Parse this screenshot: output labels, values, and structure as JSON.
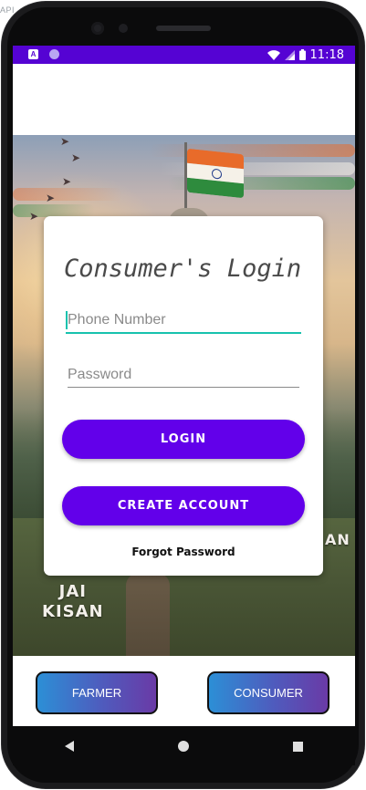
{
  "window": {
    "corner_label": "API"
  },
  "status_bar": {
    "time": "11:18",
    "accent_color": "#5503d3",
    "icons": [
      "notification-a-icon",
      "circle-icon",
      "wifi-icon",
      "signal-icon",
      "battery-icon"
    ]
  },
  "hero": {
    "jai_kisan_line1": "JAI",
    "jai_kisan_line2": "KISAN",
    "side_text": "AN"
  },
  "login_card": {
    "title": "Consumer's Login",
    "phone_placeholder": "Phone Number",
    "phone_value": "",
    "password_placeholder": "Password",
    "password_value": "",
    "login_label": "LOGIN",
    "create_account_label": "CREATE ACCOUNT",
    "forgot_password_label": "Forgot Password",
    "button_color": "#6200ea",
    "focus_color": "#17c2ae"
  },
  "role_switch": {
    "farmer_label": "FARMER",
    "consumer_label": "CONSUMER"
  },
  "nav_bar": {
    "icons": [
      "back-icon",
      "home-icon",
      "recents-icon"
    ]
  }
}
